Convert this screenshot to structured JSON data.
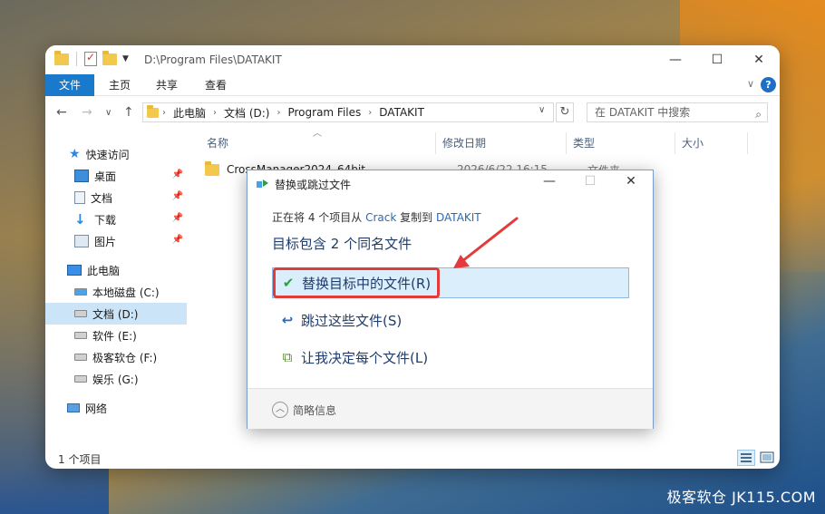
{
  "window": {
    "title_path": "D:\\Program Files\\DATAKIT",
    "minimize": "—",
    "maximize": "☐",
    "close": "✕"
  },
  "ribbon": {
    "tabs": [
      "文件",
      "主页",
      "共享",
      "查看"
    ]
  },
  "address": {
    "crumbs": [
      "此电脑",
      "文档 (D:)",
      "Program Files",
      "DATAKIT"
    ],
    "search_placeholder": "在 DATAKIT 中搜索"
  },
  "sidebar": {
    "quick_access": "快速访问",
    "items": [
      "桌面",
      "文档",
      "下载",
      "图片"
    ],
    "this_pc": "此电脑",
    "drives": [
      "本地磁盘 (C:)",
      "文档 (D:)",
      "软件 (E:)",
      "极客软仓 (F:)",
      "娱乐 (G:)"
    ],
    "network": "网络"
  },
  "columns": {
    "name": "名称",
    "modified": "修改日期",
    "type": "类型",
    "size": "大小"
  },
  "files": [
    {
      "name": "CrossManager2024_64bit",
      "modified": "2026/6/22 16:15",
      "type": "文件夹"
    }
  ],
  "status": {
    "count": "1 个项目"
  },
  "dialog": {
    "title": "替换或跳过文件",
    "line1_prefix": "正在将 4 个项目从",
    "source": "Crack",
    "line1_mid": "复制到",
    "dest": "DATAKIT",
    "line2": "目标包含 2 个同名文件",
    "option_replace": "替换目标中的文件(R)",
    "option_skip": "跳过这些文件(S)",
    "option_decide": "让我决定每个文件(L)",
    "footer": "简略信息"
  },
  "watermark": "极客软仓 JK115.COM",
  "colors": {
    "accent": "#1979ca",
    "highlight": "#e23b3b",
    "check": "#2f9e44"
  }
}
